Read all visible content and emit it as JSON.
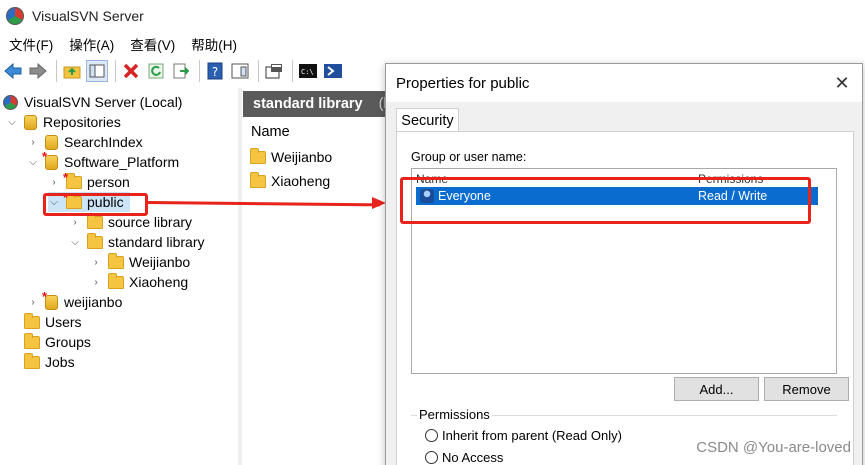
{
  "window": {
    "title": "VisualSVN Server"
  },
  "menu": [
    "文件(F)",
    "操作(A)",
    "查看(V)",
    "帮助(H)"
  ],
  "toolbar": {
    "icons": [
      "back-arrow-icon",
      "forward-arrow-icon",
      "up-folder-icon",
      "show-hide-tree-icon",
      "delete-icon",
      "refresh-icon",
      "export-icon",
      "help-icon",
      "properties-panel-icon",
      "properties-icon",
      "console-icon",
      "powershell-icon"
    ]
  },
  "tree": {
    "root": "VisualSVN Server (Local)",
    "repositories": "Repositories",
    "search_index": "SearchIndex",
    "software_platform": "Software_Platform",
    "person": "person",
    "public": "public",
    "source_library": "source library",
    "standard_library": "standard library",
    "weijianbo_folder": "Weijianbo",
    "xiaoheng_folder": "Xiaoheng",
    "weijianbo_repo": "weijianbo",
    "users": "Users",
    "groups": "Groups",
    "jobs": "Jobs"
  },
  "right_panel": {
    "header": "standard library",
    "header_extra": "(h",
    "column_name": "Name",
    "items": [
      "Weijianbo",
      "Xiaoheng"
    ]
  },
  "dialog": {
    "title": "Properties for public",
    "close_glyph": "✕",
    "tab": "Security",
    "group_label": "Group or user name:",
    "columns": {
      "name": "Name",
      "permissions": "Permissions"
    },
    "rows": [
      {
        "name": "Everyone",
        "permissions": "Read / Write"
      }
    ],
    "add_button": "Add...",
    "remove_button": "Remove",
    "permissions_label": "Permissions",
    "options": [
      "Inherit from parent (Read Only)",
      "No Access"
    ]
  },
  "watermark": "CSDN @You-are-loved",
  "colors": {
    "highlight_red": "#e8231b",
    "selection_blue": "#0b6ccf",
    "header_gray": "#5a5a5a"
  }
}
